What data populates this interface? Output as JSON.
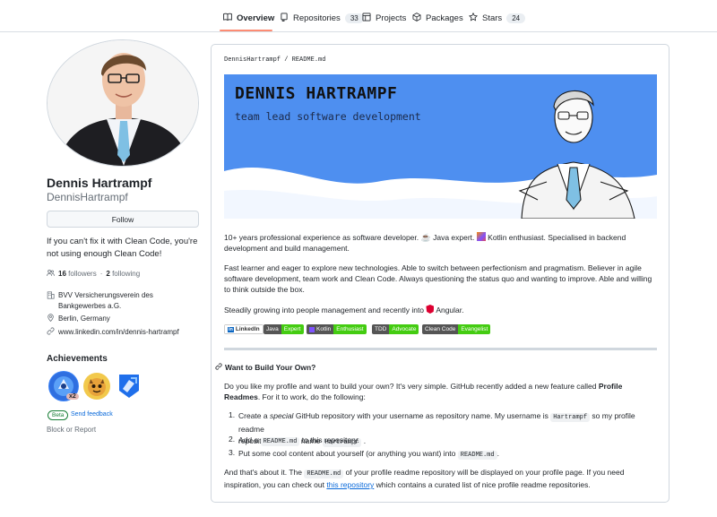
{
  "nav": {
    "tabs": [
      {
        "label": "Overview",
        "icon": "book-icon"
      },
      {
        "label": "Repositories",
        "count": "33",
        "icon": "repo-icon"
      },
      {
        "label": "Projects",
        "icon": "table-icon"
      },
      {
        "label": "Packages",
        "icon": "package-icon"
      },
      {
        "label": "Stars",
        "count": "24",
        "icon": "star-icon"
      }
    ]
  },
  "profile": {
    "name": "Dennis Hartrampf",
    "login": "DennisHartrampf",
    "follow_label": "Follow",
    "bio": "If you can't fix it with Clean Code, you're not using enough Clean Code!",
    "followers": "16",
    "followers_label": "followers",
    "sep": "·",
    "following": "2",
    "following_label": "following",
    "org_line1": "BVV Versicherungsverein des",
    "org_line2": "Bankgewerbes a.G.",
    "location": "Berlin, Germany",
    "website": "www.linkedin.com/in/dennis-hartrampf"
  },
  "achievements": {
    "title": "Achievements",
    "multiplier": "x2",
    "beta_label": "Beta",
    "feedback_label": "Send feedback",
    "block_label": "Block or Report"
  },
  "readme": {
    "path_user": "DennisHartrampf",
    "path_sep": "/",
    "path_file": "README.md",
    "banner_title": "DENNIS HARTRAMPF",
    "banner_subtitle": "team lead software development",
    "p1_a": "10+ years professional experience as software developer.",
    "p1_b": "Java expert.",
    "p1_c": "Kotlin enthusiast. Specialised in backend development and",
    "p1_d": "build management.",
    "p2_l1": "Fast learner and eager to explore new technologies. Able to switch between perfectionism and pragmatism. Believer in agile software",
    "p2_l2": "development, team work and Clean Code. Always questioning the status quo and wanting to improve. Able and willing to think outside",
    "p2_l3": "the box.",
    "p3_a": "Steadily growing into people management and recently into",
    "p3_b": "Angular.",
    "shields": [
      {
        "left": "LinkedIn",
        "right": ""
      },
      {
        "left": "Java",
        "right": "Expert"
      },
      {
        "left": "Kotlin",
        "right": "Enthusiast"
      },
      {
        "left": "TDD",
        "right": "Advocate"
      },
      {
        "left": "Clean Code",
        "right": "Evangelist"
      }
    ],
    "heading": "Want to Build Your Own?",
    "p4_l1_a": "Do you like my profile and want to build your own? It's very simple. GitHub recently added a new feature called",
    "p4_l1_b": "Profile Readmes",
    "p4_l1_c": ". For it",
    "p4_l2": "to work, do the following:",
    "li1_a": "Create a",
    "li1_em": "special",
    "li1_b": "GitHub repository with your username as repository name. My username is",
    "li1_code": "Hartrampf",
    "li1_c": "so my profile readme",
    "li1_l2": "repository has the name",
    "li1_code2": "Hartrampf",
    "li1_end": ".",
    "li2_a": "Add a",
    "li2_code": "README.md",
    "li2_b": "to this repository.",
    "li3_a": "Put some cool content about yourself (or anything you want) into",
    "li3_code": "README.md",
    "li3_b": ".",
    "p5_l1_a": "And that's about it. The",
    "p5_code": "README.md",
    "p5_l1_b": "of your profile readme repository will be displayed on your profile page. If you need inspiration, you",
    "p5_l2_a": "can check out",
    "p5_link": "this repository",
    "p5_l2_b": "which contains a curated list of nice profile readme repositories."
  },
  "colors": {
    "accent_underline": "#fd8c73",
    "link": "#0969da",
    "banner_blue": "#4e8ff0",
    "shield_green": "#4c1",
    "shield_purple": "#7f52ff"
  }
}
